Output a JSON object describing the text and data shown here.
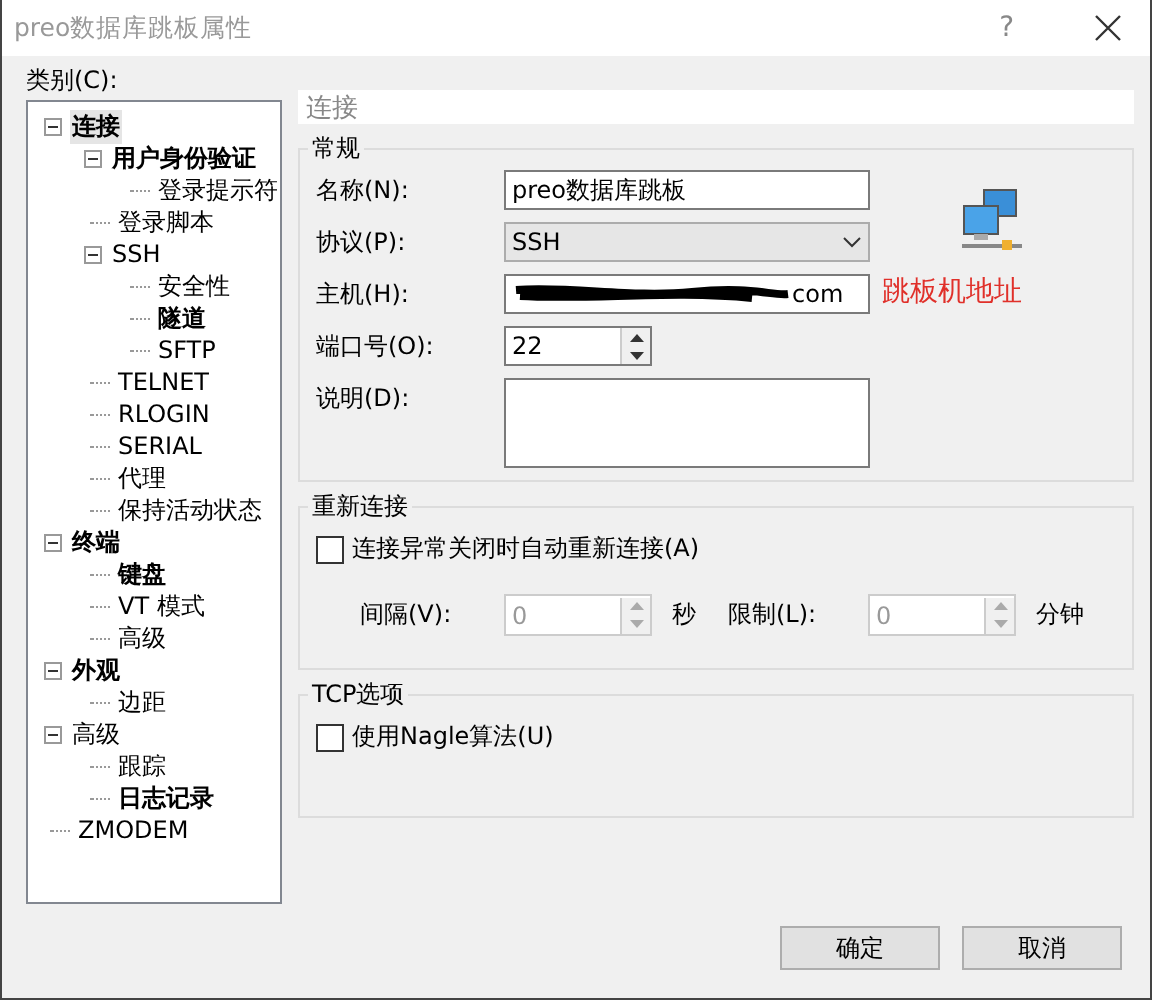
{
  "window": {
    "title": "preo数据库跳板属性",
    "help": "?"
  },
  "category_label": "类别(C):",
  "tree": [
    {
      "label": "连接",
      "bold": true,
      "selected": true,
      "expanded": true,
      "children": [
        {
          "label": "用户身份验证",
          "bold": true,
          "selected": false,
          "expanded": true,
          "children": [
            {
              "label": "登录提示符",
              "bold": false,
              "selected": false
            }
          ]
        },
        {
          "label": "登录脚本",
          "bold": false,
          "selected": false
        },
        {
          "label": "SSH",
          "bold": false,
          "selected": false,
          "expanded": true,
          "children": [
            {
              "label": "安全性",
              "bold": false,
              "selected": false
            },
            {
              "label": "隧道",
              "bold": true,
              "selected": false
            },
            {
              "label": "SFTP",
              "bold": false,
              "selected": false
            }
          ]
        },
        {
          "label": "TELNET",
          "bold": false,
          "selected": false
        },
        {
          "label": "RLOGIN",
          "bold": false,
          "selected": false
        },
        {
          "label": "SERIAL",
          "bold": false,
          "selected": false
        },
        {
          "label": "代理",
          "bold": false,
          "selected": false
        },
        {
          "label": "保持活动状态",
          "bold": false,
          "selected": false
        }
      ]
    },
    {
      "label": "终端",
      "bold": true,
      "selected": false,
      "expanded": true,
      "children": [
        {
          "label": "键盘",
          "bold": true,
          "selected": false
        },
        {
          "label": "VT 模式",
          "bold": false,
          "selected": false
        },
        {
          "label": "高级",
          "bold": false,
          "selected": false
        }
      ]
    },
    {
      "label": "外观",
      "bold": true,
      "selected": false,
      "expanded": true,
      "children": [
        {
          "label": "边距",
          "bold": false,
          "selected": false
        }
      ]
    },
    {
      "label": "高级",
      "bold": false,
      "selected": false,
      "expanded": true,
      "children": [
        {
          "label": "跟踪",
          "bold": false,
          "selected": false
        },
        {
          "label": "日志记录",
          "bold": true,
          "selected": false
        }
      ]
    },
    {
      "label": "ZMODEM",
      "bold": false,
      "selected": false
    }
  ],
  "panel": {
    "heading": "连接",
    "general": {
      "title": "常规",
      "annotation": "跳板机地址",
      "fields": [
        {
          "kind": "text",
          "label": "名称(N):",
          "value": "preo数据库跳板",
          "redacted": false
        },
        {
          "kind": "select",
          "label": "协议(P):",
          "value": "SSH"
        },
        {
          "kind": "text",
          "label": "主机(H):",
          "value": "com",
          "redacted": true
        },
        {
          "kind": "spin",
          "label": "端口号(O):",
          "value": "22"
        },
        {
          "kind": "textarea",
          "label": "说明(D):"
        }
      ]
    },
    "reconnect": {
      "title": "重新连接",
      "checkbox": {
        "label": "连接异常关闭时自动重新连接(A)",
        "checked": false
      },
      "spins": [
        {
          "label": "间隔(V):",
          "value": "0",
          "unit": "秒",
          "disabled": true
        },
        {
          "label": "限制(L):",
          "value": "0",
          "unit": "分钟",
          "disabled": true
        }
      ]
    },
    "tcp": {
      "title": "TCP选项",
      "checkbox": {
        "label": "使用Nagle算法(U)",
        "checked": false
      }
    }
  },
  "buttons": [
    {
      "label": "确定"
    },
    {
      "label": "取消"
    }
  ]
}
